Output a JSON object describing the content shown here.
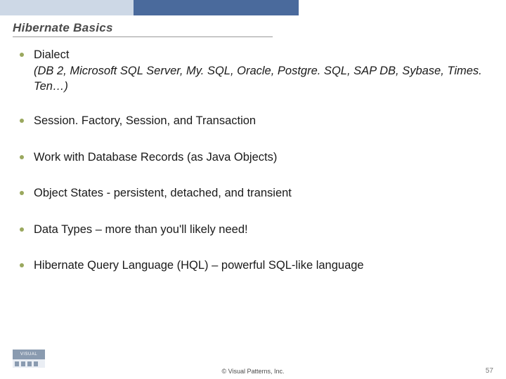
{
  "header": {
    "title": "Hibernate Basics"
  },
  "bullets": [
    {
      "main": "Dialect",
      "sub": "(DB 2, Microsoft SQL Server, My. SQL, Oracle, Postgre. SQL, SAP DB, Sybase, Times. Ten…)"
    },
    {
      "main": "Session. Factory, Session, and Transaction"
    },
    {
      "main": "Work with Database Records (as Java Objects)"
    },
    {
      "main": "Object States - persistent, detached, and transient"
    },
    {
      "main": "Data Types – more than you'll likely need!"
    },
    {
      "main": "Hibernate Query Language (HQL) – powerful SQL-like language"
    }
  ],
  "footer": {
    "copyright": "© Visual Patterns, Inc.",
    "page_number": "57",
    "logo_text": "VISUAL"
  }
}
